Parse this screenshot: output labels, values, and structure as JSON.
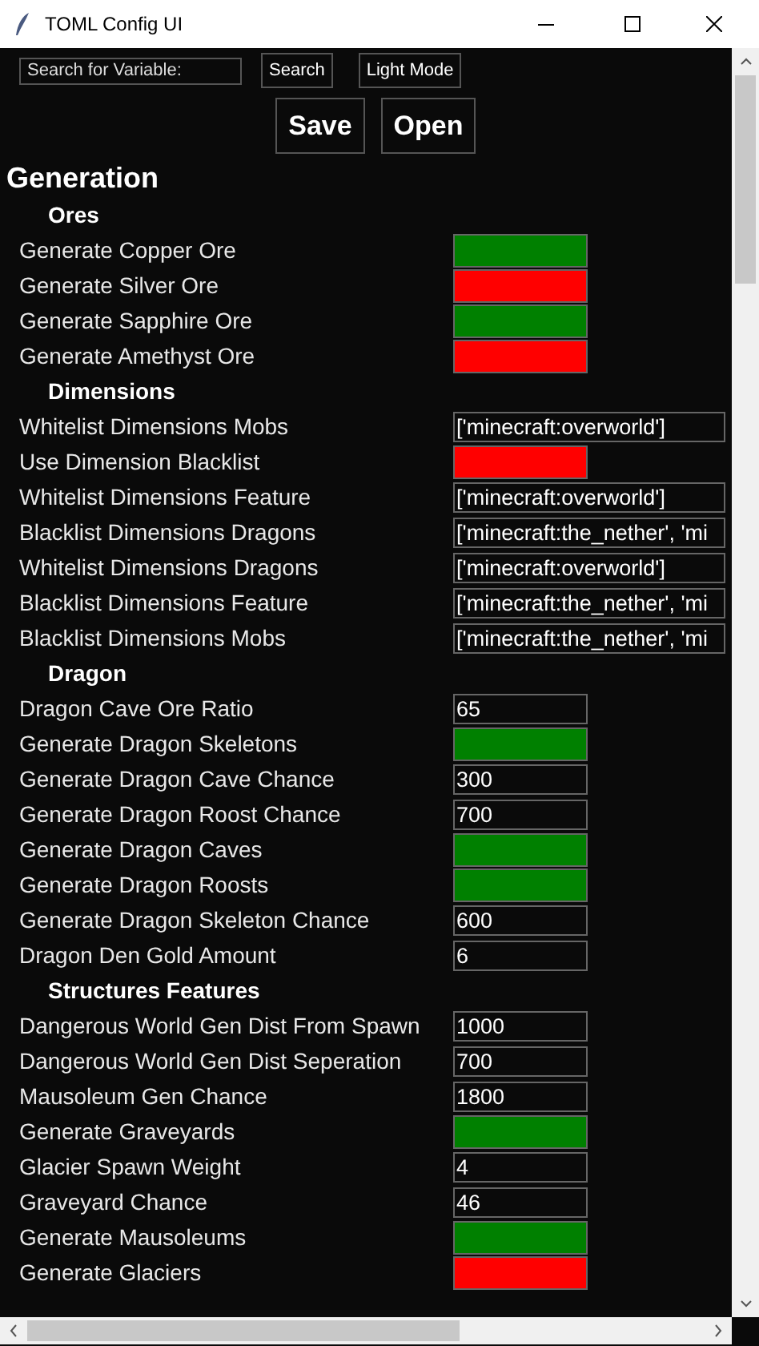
{
  "window": {
    "title": "TOML Config UI"
  },
  "toolbar": {
    "search": {
      "placeholder": "Search for Variable:"
    },
    "search_button": "Search",
    "theme_button": "Light Mode",
    "save_button": "Save",
    "open_button": "Open"
  },
  "section": {
    "title": "Generation",
    "groups": [
      {
        "title": "Ores",
        "items": [
          {
            "label": "Generate Copper Ore",
            "kind": "toggle",
            "on": true
          },
          {
            "label": "Generate Silver Ore",
            "kind": "toggle",
            "on": false
          },
          {
            "label": "Generate Sapphire Ore",
            "kind": "toggle",
            "on": true
          },
          {
            "label": "Generate Amethyst Ore",
            "kind": "toggle",
            "on": false
          }
        ]
      },
      {
        "title": "Dimensions",
        "items": [
          {
            "label": "Whitelist Dimensions Mobs",
            "kind": "list",
            "value": "['minecraft:overworld']"
          },
          {
            "label": "Use Dimension Blacklist",
            "kind": "toggle",
            "on": false
          },
          {
            "label": "Whitelist Dimensions Feature",
            "kind": "list",
            "value": "['minecraft:overworld']"
          },
          {
            "label": "Blacklist Dimensions Dragons",
            "kind": "list",
            "value": "['minecraft:the_nether', 'mi"
          },
          {
            "label": "Whitelist Dimensions Dragons",
            "kind": "list",
            "value": "['minecraft:overworld']"
          },
          {
            "label": "Blacklist Dimensions Feature",
            "kind": "list",
            "value": "['minecraft:the_nether', 'mi"
          },
          {
            "label": "Blacklist Dimensions Mobs",
            "kind": "list",
            "value": "['minecraft:the_nether', 'mi"
          }
        ]
      },
      {
        "title": "Dragon",
        "items": [
          {
            "label": "Dragon Cave Ore Ratio",
            "kind": "number",
            "value": "65"
          },
          {
            "label": "Generate Dragon Skeletons",
            "kind": "toggle",
            "on": true
          },
          {
            "label": "Generate Dragon Cave Chance",
            "kind": "number",
            "value": "300"
          },
          {
            "label": "Generate Dragon Roost Chance",
            "kind": "number",
            "value": "700"
          },
          {
            "label": "Generate Dragon Caves",
            "kind": "toggle",
            "on": true
          },
          {
            "label": "Generate Dragon Roosts",
            "kind": "toggle",
            "on": true
          },
          {
            "label": "Generate Dragon Skeleton Chance",
            "kind": "number",
            "value": "600"
          },
          {
            "label": "Dragon Den Gold Amount",
            "kind": "number",
            "value": "6"
          }
        ]
      },
      {
        "title": "Structures Features",
        "items": [
          {
            "label": "Dangerous World Gen Dist From Spawn",
            "kind": "number",
            "value": "1000"
          },
          {
            "label": "Dangerous World Gen Dist Seperation",
            "kind": "number",
            "value": "700"
          },
          {
            "label": "Mausoleum Gen Chance",
            "kind": "number",
            "value": "1800"
          },
          {
            "label": "Generate Graveyards",
            "kind": "toggle",
            "on": true
          },
          {
            "label": "Glacier Spawn Weight",
            "kind": "number",
            "value": "4"
          },
          {
            "label": "Graveyard Chance",
            "kind": "number",
            "value": "46"
          },
          {
            "label": "Generate Mausoleums",
            "kind": "toggle",
            "on": true
          },
          {
            "label": "Generate Glaciers",
            "kind": "toggle",
            "on": false
          }
        ]
      }
    ]
  }
}
